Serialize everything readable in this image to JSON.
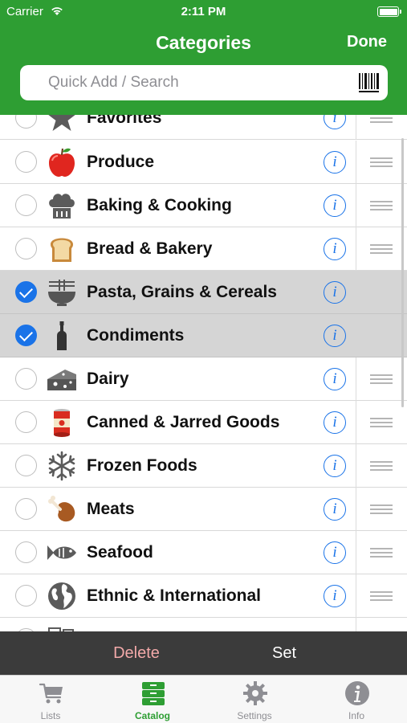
{
  "status": {
    "carrier": "Carrier",
    "time": "2:11 PM"
  },
  "nav": {
    "title": "Categories",
    "done_label": "Done"
  },
  "search": {
    "placeholder": "Quick Add / Search"
  },
  "categories": [
    {
      "label": "Favorites",
      "icon": "star-icon",
      "selected": false
    },
    {
      "label": "Produce",
      "icon": "apple-icon",
      "selected": false
    },
    {
      "label": "Baking & Cooking",
      "icon": "chef-hat-icon",
      "selected": false
    },
    {
      "label": "Bread & Bakery",
      "icon": "bread-icon",
      "selected": false
    },
    {
      "label": "Pasta, Grains & Cereals",
      "icon": "bowl-icon",
      "selected": true
    },
    {
      "label": "Condiments",
      "icon": "bottle-icon",
      "selected": true
    },
    {
      "label": "Dairy",
      "icon": "cheese-icon",
      "selected": false
    },
    {
      "label": "Canned & Jarred Goods",
      "icon": "can-icon",
      "selected": false
    },
    {
      "label": "Frozen Foods",
      "icon": "snowflake-icon",
      "selected": false
    },
    {
      "label": "Meats",
      "icon": "drumstick-icon",
      "selected": false
    },
    {
      "label": "Seafood",
      "icon": "fish-icon",
      "selected": false
    },
    {
      "label": "Ethnic & International",
      "icon": "globe-icon",
      "selected": false
    }
  ],
  "actions": {
    "delete_label": "Delete",
    "set_label": "Set"
  },
  "tabs": [
    {
      "label": "Lists",
      "icon": "cart-icon"
    },
    {
      "label": "Catalog",
      "icon": "catalog-icon"
    },
    {
      "label": "Settings",
      "icon": "gear-icon"
    },
    {
      "label": "Info",
      "icon": "info-icon"
    }
  ],
  "colors": {
    "brand_green": "#2e9e33",
    "accent_blue": "#1a73e8",
    "delete_pink": "#f2a9a9"
  }
}
